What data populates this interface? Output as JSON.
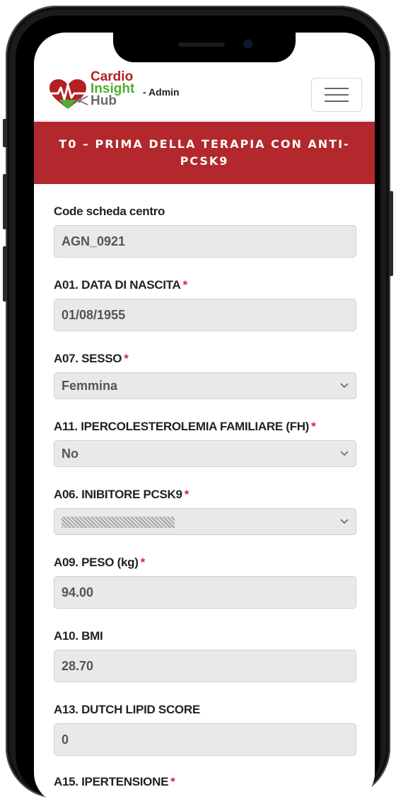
{
  "app": {
    "logo_line1": "Cardio",
    "logo_line2": "Insight",
    "logo_line3": "Hub",
    "user_role": "- Admin"
  },
  "banner": {
    "title": "T0 – PRIMA DELLA TERAPIA CON ANTI-PCSK9"
  },
  "form": {
    "code_scheda": {
      "label": "Code scheda centro",
      "value": "AGN_0921"
    },
    "data_nascita": {
      "label": "A01. DATA DI NASCITA",
      "required": "*",
      "value": "01/08/1955"
    },
    "sesso": {
      "label": "A07. SESSO",
      "required": "*",
      "value": "Femmina"
    },
    "ipercolesterolemia": {
      "label": "A11. IPERCOLESTEROLEMIA FAMILIARE (FH)",
      "required": "*",
      "value": "No"
    },
    "inibitore": {
      "label": "A06. INIBITORE PCSK9",
      "required": "*"
    },
    "peso": {
      "label": "A09. PESO (kg)",
      "required": "*",
      "value": "94.00"
    },
    "bmi": {
      "label": "A10. BMI",
      "value": "28.70"
    },
    "dutch_score": {
      "label": "A13. DUTCH LIPID SCORE",
      "value": "0"
    },
    "ipertensione": {
      "label": "A15. IPERTENSIONE",
      "required": "*"
    }
  },
  "icons": {
    "menu": "hamburger-icon",
    "select_arrow": "chevron-down-icon",
    "logo": "heart-pulse-icon"
  },
  "colors": {
    "banner_bg": "#b2282d",
    "required": "#d9262f",
    "logo_red": "#b32024",
    "logo_green": "#4caf2f"
  }
}
